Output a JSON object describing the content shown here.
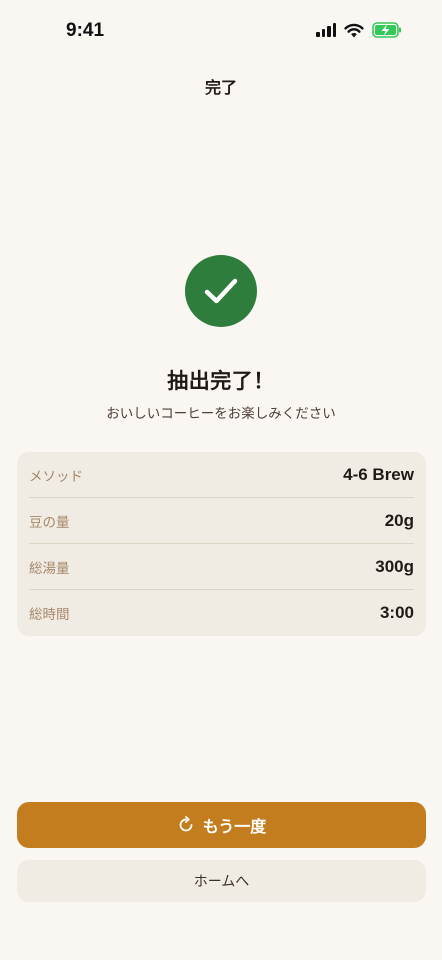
{
  "status_bar": {
    "time": "9:41",
    "icons": [
      "signal-icon",
      "wifi-icon",
      "battery-charging-icon"
    ],
    "battery_color": "#34C759"
  },
  "nav": {
    "title": "完了"
  },
  "result": {
    "icon": "checkmark-icon",
    "badge_color": "#2E7D3C",
    "headline": "抽出完了！",
    "subline": "おいしいコーヒーをお楽しみください"
  },
  "summary": {
    "rows": [
      {
        "label": "メソッド",
        "value": "4-6 Brew"
      },
      {
        "label": "豆の量",
        "value": "20g"
      },
      {
        "label": "総湯量",
        "value": "300g"
      },
      {
        "label": "総時間",
        "value": "3:00"
      }
    ]
  },
  "actions": {
    "primary_label": "もう一度",
    "primary_icon": "refresh-icon",
    "primary_color": "#C47D1E",
    "secondary_label": "ホームへ"
  }
}
